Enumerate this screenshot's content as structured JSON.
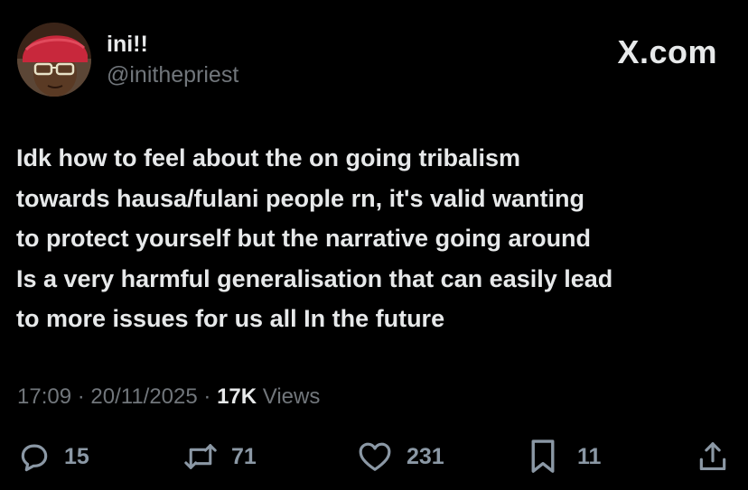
{
  "author": {
    "display_name": "ini!!",
    "handle": "@inithepriest"
  },
  "brand": "X.com",
  "tweet": {
    "lines": [
      "Idk how to feel about the on going tribalism",
      "towards hausa/fulani people rn, it's  valid wanting",
      "to protect yourself but the narrative going around",
      "Is a very harmful generalisation that can easily lead",
      "to more issues for us all In the future"
    ]
  },
  "meta": {
    "time": "17:09",
    "separator": " · ",
    "date": "20/11/2025",
    "views_count": "17K",
    "views_label": " Views"
  },
  "actions": {
    "replies": "15",
    "reposts": "71",
    "likes": "231",
    "bookmarks": "11"
  },
  "colors": {
    "background": "#000000",
    "primary_text": "#e7e9ea",
    "secondary_text": "#71767b",
    "icon": "#8b98a5"
  },
  "icons": {
    "reply": "speech-bubble-icon",
    "repost": "repost-arrows-icon",
    "like": "heart-icon",
    "bookmark": "bookmark-icon",
    "share": "share-upload-icon"
  }
}
